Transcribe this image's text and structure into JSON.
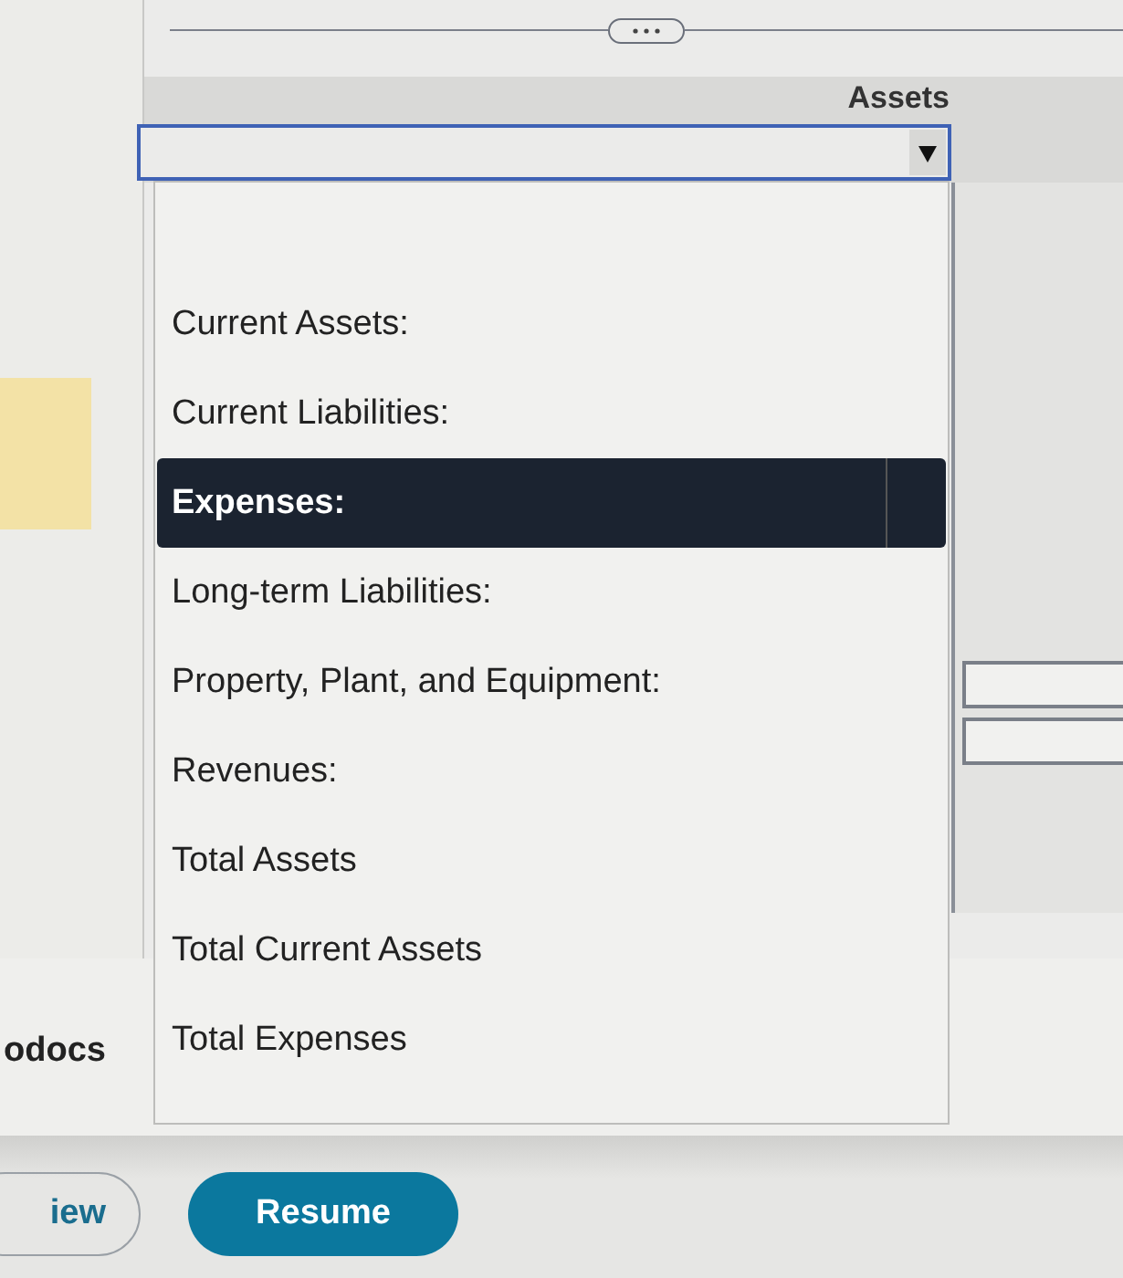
{
  "table": {
    "column_header": "Assets"
  },
  "dropdown": {
    "options": [
      {
        "label": "Current Assets:",
        "selected": false
      },
      {
        "label": "Current Liabilities:",
        "selected": false
      },
      {
        "label": "Expenses:",
        "selected": true
      },
      {
        "label": "Long-term Liabilities:",
        "selected": false
      },
      {
        "label": "Property, Plant, and Equipment:",
        "selected": false
      },
      {
        "label": "Revenues:",
        "selected": false
      },
      {
        "label": "Total Assets",
        "selected": false
      },
      {
        "label": "Total Current Assets",
        "selected": false
      },
      {
        "label": "Total Expenses",
        "selected": false
      }
    ]
  },
  "side_label": "odocs",
  "buttons": [
    {
      "label": "iew",
      "kind": "outline"
    },
    {
      "label": "Resume",
      "kind": "primary"
    }
  ]
}
